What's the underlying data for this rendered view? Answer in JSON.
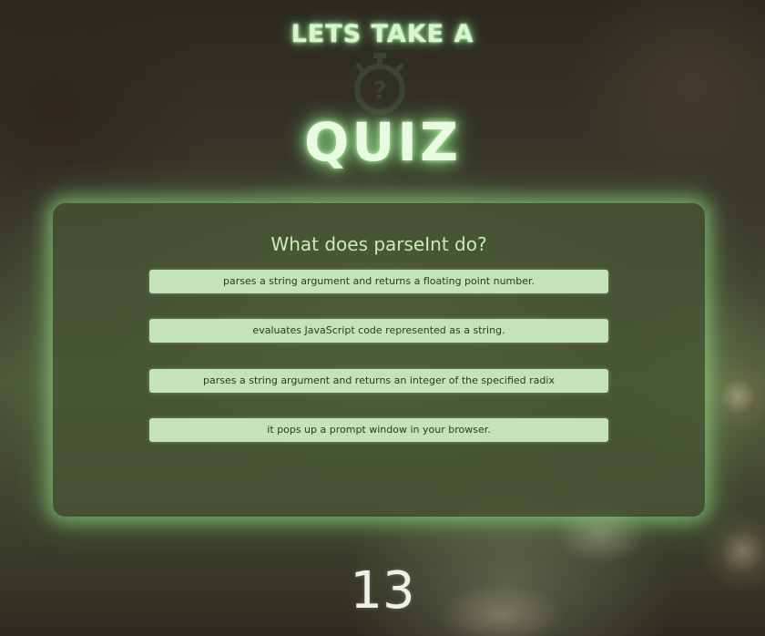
{
  "header": {
    "title_top": "LETS TAKE A",
    "title_main": "QUIZ",
    "icon": "stopwatch-question-icon"
  },
  "quiz": {
    "question": "What does parseInt do?",
    "answers": [
      "parses a string argument and returns a floating point number.",
      "evaluates JavaScript code represented as a string.",
      "parses a string argument and returns an integer of the specified radix",
      "it pops up a prompt window in your browser."
    ]
  },
  "timer": {
    "value": "13"
  },
  "colors": {
    "glow": "#9fe58f",
    "card_bg": "#485634",
    "answer_bg": "#c3e3bb",
    "question_text": "#c9ecb5"
  }
}
